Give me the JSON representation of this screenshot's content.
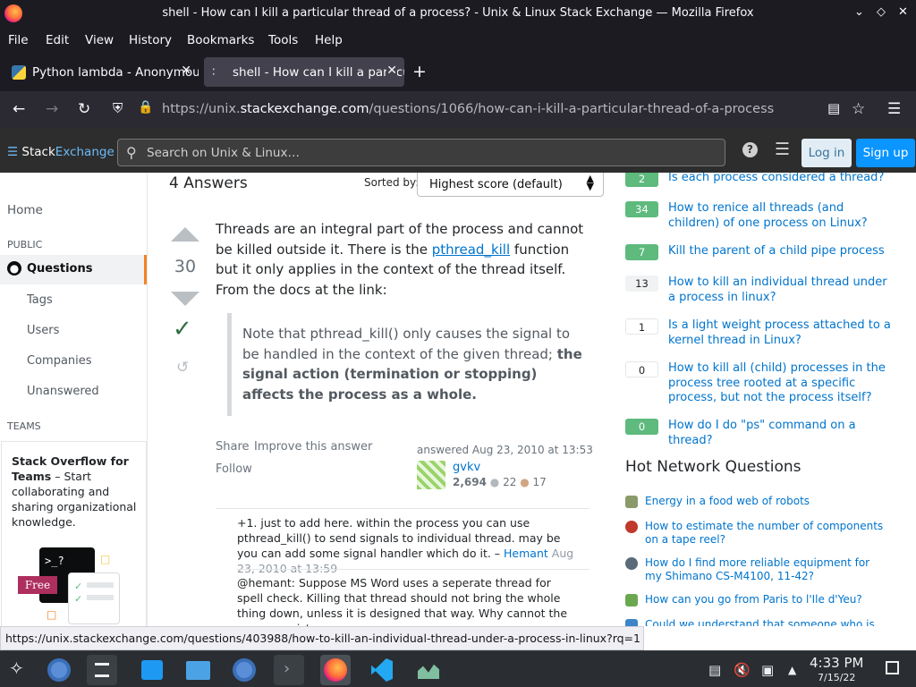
{
  "window": {
    "title": "shell - How can I kill a particular thread of a process? - Unix & Linux Stack Exchange — Mozilla Firefox"
  },
  "menu": [
    "File",
    "Edit",
    "View",
    "History",
    "Bookmarks",
    "Tools",
    "Help"
  ],
  "tabs": [
    {
      "label": "Python lambda - Anonymou"
    },
    {
      "label": "shell - How can I kill a particul"
    }
  ],
  "address": {
    "prefix": "https://unix.",
    "domain": "stackexchange.com",
    "path": "/questions/1066/how-can-i-kill-a-particular-thread-of-a-process"
  },
  "site": {
    "logo_a": "Stack",
    "logo_b": "Exchange",
    "search_placeholder": "Search on Unix & Linux…",
    "login": "Log in",
    "signup": "Sign up"
  },
  "leftnav": {
    "home": "Home",
    "public": "PUBLIC",
    "questions": "Questions",
    "tags": "Tags",
    "users": "Users",
    "companies": "Companies",
    "unanswered": "Unanswered",
    "teams": "TEAMS",
    "teams_title": "Stack Overflow for Teams",
    "teams_desc": " – Start collaborating and sharing organizational knowledge.",
    "free": "Free",
    "terminal": ">_?"
  },
  "answers": {
    "count": "4 Answers",
    "sorted_by": "Sorted by:",
    "sort_value": "Highest score (default)"
  },
  "answer": {
    "score": "30",
    "p1a": "Threads are an integral part of the process and cannot be killed outside it. There is the ",
    "p1link": "pthread_kill",
    "p1b": " function but it only applies in the context of the thread itself. From the docs at the link:",
    "quote_a": "Note that pthread_kill() only causes the signal to be handled in the context of the given thread; ",
    "quote_b": "the signal action (termination or stopping) affects the process as a whole.",
    "share": "Share",
    "improve": "Improve this answer",
    "follow": "Follow",
    "answered": "answered Aug 23, 2010 at 13:53",
    "user": "gvkv",
    "rep": "2,694",
    "silver": "22",
    "bronze": "17"
  },
  "comments": [
    {
      "text": "+1. just to add here. within the process you can use pthread_kill() to send signals to individual thread. may be you can add some signal handler which do it. – ",
      "user": "Hemant",
      "date": "Aug 23, 2010 at 13:59"
    },
    {
      "text": "@hemant: Suppose MS Word uses a seperate thread for spell check. Killing that thread should not bring the whole thing down, unless it is designed that way. Why cannot the process exist",
      "user": "",
      "date": ""
    }
  ],
  "related": [
    {
      "score": "2",
      "title": "Is each process considered a thread?",
      "accepted": true
    },
    {
      "score": "34",
      "title": "How to renice all threads (and children) of one process on Linux?",
      "accepted": true
    },
    {
      "score": "7",
      "title": "Kill the parent of a child pipe process",
      "accepted": true
    },
    {
      "score": "13",
      "title": "How to kill an individual thread under a process in linux?",
      "accepted": false
    },
    {
      "score": "1",
      "title": "Is a light weight process attached to a kernel thread in Linux?",
      "accepted": false
    },
    {
      "score": "0",
      "title": "How to kill all (child) processes in the process tree rooted at a specific process, but not the process itself?",
      "accepted": false
    },
    {
      "score": "0",
      "title": "How do I do \"ps\" command on a thread?",
      "accepted": true
    }
  ],
  "hnq": {
    "title": "Hot Network Questions",
    "items": [
      {
        "title": "Energy in a food web of robots",
        "color": "#8a9a6a"
      },
      {
        "title": "How to estimate the number of components on a tape reel?",
        "color": "#c0392b"
      },
      {
        "title": "How do I find more reliable equipment for my Shimano CS-M4100, 11-42?",
        "color": "#5a6a78"
      },
      {
        "title": "How can you go from Paris to l'Ile d'Yeu?",
        "color": "#6aa84f"
      },
      {
        "title": "Could we understand that someone who is still 'innocent until proven otherwise', be 'possibly'",
        "color": "#3d85c6"
      }
    ]
  },
  "status_url": "https://unix.stackexchange.com/questions/403988/how-to-kill-an-individual-thread-under-a-process-in-linux?rq=1",
  "clock": {
    "time": "4:33 PM",
    "date": "7/15/22"
  },
  "colors": {
    "accent": "#0a95ff",
    "accepted": "#5eba7d",
    "orange": "#f48225"
  }
}
